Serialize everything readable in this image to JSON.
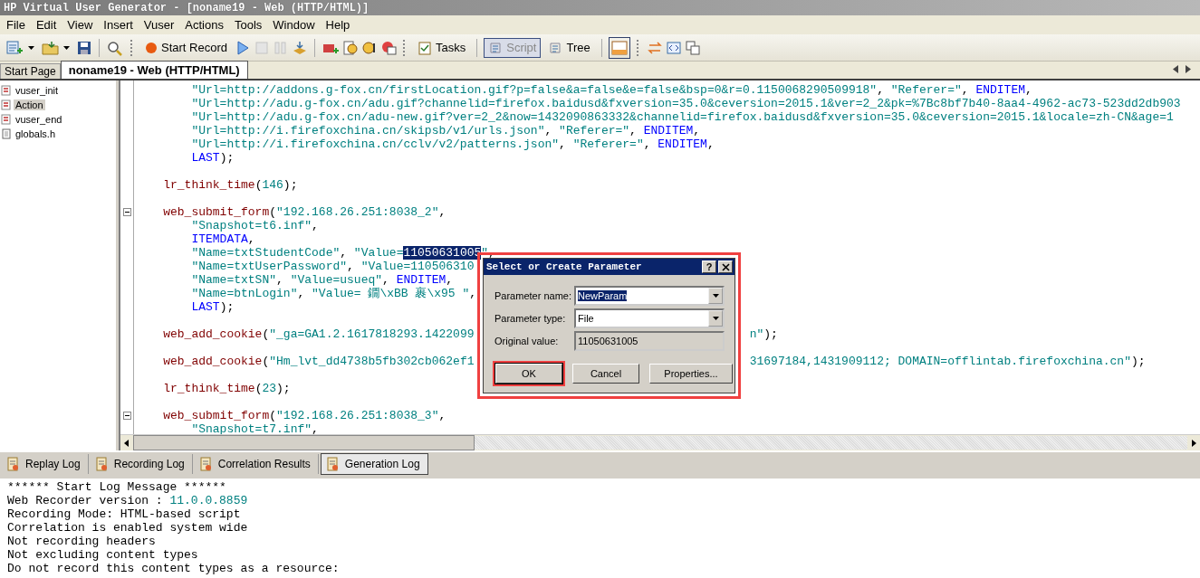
{
  "window": {
    "title": "HP Virtual User Generator - [noname19 - Web (HTTP/HTML)]"
  },
  "menu": [
    "File",
    "Edit",
    "View",
    "Insert",
    "Vuser",
    "Actions",
    "Tools",
    "Window",
    "Help"
  ],
  "toolbar": {
    "start_record": "Start Record",
    "tasks": "Tasks",
    "view_buttons": [
      {
        "label": "Script",
        "selected": true
      },
      {
        "label": "Tree",
        "selected": false
      }
    ]
  },
  "doc_tabs": [
    {
      "label": "Start Page",
      "selected": false
    },
    {
      "label": "noname19 - Web (HTTP/HTML)",
      "selected": true
    }
  ],
  "sidebar": {
    "items": [
      {
        "label": "vuser_init",
        "kind": "action",
        "selected": false
      },
      {
        "label": "Action",
        "kind": "action",
        "selected": true
      },
      {
        "label": "vuser_end",
        "kind": "action",
        "selected": false
      },
      {
        "label": "globals.h",
        "kind": "header",
        "selected": false
      }
    ]
  },
  "editor": {
    "lines": [
      {
        "fold": false,
        "tokens": [
          {
            "kind": "str",
            "text": "        \"Url=http://addons.g-fox.cn/firstLocation.gif?p=false&a=false&e=false&bsp=0&r=0.1150068290509918\""
          },
          {
            "kind": "plain",
            "text": ", "
          },
          {
            "kind": "str",
            "text": "\"Referer=\""
          },
          {
            "kind": "plain",
            "text": ", "
          },
          {
            "kind": "kw",
            "text": "ENDITEM"
          },
          {
            "kind": "plain",
            "text": ","
          }
        ]
      },
      {
        "fold": false,
        "tokens": [
          {
            "kind": "str",
            "text": "        \"Url=http://adu.g-fox.cn/adu.gif?channelid=firefox.baidusd&fxversion=35.0&ceversion=2015.1&ver=2_2&pk=%7Bc8bf7b40-8aa4-4962-ac73-523dd2db903"
          }
        ]
      },
      {
        "fold": false,
        "tokens": [
          {
            "kind": "str",
            "text": "        \"Url=http://adu.g-fox.cn/adu-new.gif?ver=2_2&now=1432090863332&channelid=firefox.baidusd&fxversion=35.0&ceversion=2015.1&locale=zh-CN&age=1"
          }
        ]
      },
      {
        "fold": false,
        "tokens": [
          {
            "kind": "str",
            "text": "        \"Url=http://i.firefoxchina.cn/skipsb/v1/urls.json\""
          },
          {
            "kind": "plain",
            "text": ", "
          },
          {
            "kind": "str",
            "text": "\"Referer=\""
          },
          {
            "kind": "plain",
            "text": ", "
          },
          {
            "kind": "kw",
            "text": "ENDITEM"
          },
          {
            "kind": "plain",
            "text": ","
          }
        ]
      },
      {
        "fold": false,
        "tokens": [
          {
            "kind": "str",
            "text": "        \"Url=http://i.firefoxchina.cn/cclv/v2/patterns.json\""
          },
          {
            "kind": "plain",
            "text": ", "
          },
          {
            "kind": "str",
            "text": "\"Referer=\""
          },
          {
            "kind": "plain",
            "text": ", "
          },
          {
            "kind": "kw",
            "text": "ENDITEM"
          },
          {
            "kind": "plain",
            "text": ","
          }
        ]
      },
      {
        "fold": false,
        "tokens": [
          {
            "kind": "kw",
            "text": "        LAST"
          },
          {
            "kind": "plain",
            "text": ");"
          }
        ]
      },
      {
        "fold": false
      },
      {
        "fold": false,
        "tokens": [
          {
            "kind": "fn",
            "text": "    lr_think_time"
          },
          {
            "kind": "plain",
            "text": "("
          },
          {
            "kind": "str",
            "text": "146"
          },
          {
            "kind": "plain",
            "text": ");"
          }
        ]
      },
      {
        "fold": false
      },
      {
        "fold": true,
        "tokens": [
          {
            "kind": "fn",
            "text": "    web_submit_form"
          },
          {
            "kind": "plain",
            "text": "("
          },
          {
            "kind": "str",
            "text": "\"192.168.26.251:8038_2\""
          },
          {
            "kind": "plain",
            "text": ","
          }
        ]
      },
      {
        "fold": false,
        "tokens": [
          {
            "kind": "str",
            "text": "        \"Snapshot=t6.inf\""
          },
          {
            "kind": "plain",
            "text": ","
          }
        ]
      },
      {
        "fold": false,
        "tokens": [
          {
            "kind": "kw",
            "text": "        ITEMDATA"
          },
          {
            "kind": "plain",
            "text": ","
          }
        ]
      },
      {
        "fold": false,
        "tokens": [
          {
            "kind": "str",
            "text": "        \"Name=txtStudentCode\""
          },
          {
            "kind": "plain",
            "text": ", "
          },
          {
            "kind": "str",
            "text": "\"Value="
          },
          {
            "kind": "sel",
            "text": "11050631005"
          },
          {
            "kind": "str",
            "text": "\""
          },
          {
            "kind": "plain",
            "text": ","
          }
        ]
      },
      {
        "fold": false,
        "tokens": [
          {
            "kind": "str",
            "text": "        \"Name=txtUserPassword\""
          },
          {
            "kind": "plain",
            "text": ", "
          },
          {
            "kind": "str",
            "text": "\"Value=110506310"
          }
        ]
      },
      {
        "fold": false,
        "tokens": [
          {
            "kind": "str",
            "text": "        \"Name=txtSN\""
          },
          {
            "kind": "plain",
            "text": ", "
          },
          {
            "kind": "str",
            "text": "\"Value=usueq\""
          },
          {
            "kind": "plain",
            "text": ", "
          },
          {
            "kind": "kw",
            "text": "ENDITEM"
          },
          {
            "kind": "plain",
            "text": ","
          }
        ]
      },
      {
        "fold": false,
        "tokens": [
          {
            "kind": "str",
            "text": "        \"Name=btnLogin\""
          },
          {
            "kind": "plain",
            "text": ", "
          },
          {
            "kind": "str",
            "text": "\"Value= 鐗\\xBB 裹\\x95 \""
          },
          {
            "kind": "plain",
            "text": ","
          }
        ]
      },
      {
        "fold": false,
        "tokens": [
          {
            "kind": "kw",
            "text": "        LAST"
          },
          {
            "kind": "plain",
            "text": ");"
          }
        ]
      },
      {
        "fold": false
      },
      {
        "fold": false,
        "tokens": [
          {
            "kind": "fn",
            "text": "    web_add_cookie"
          },
          {
            "kind": "plain",
            "text": "("
          },
          {
            "kind": "str",
            "text": "\"_ga=GA1.2.1617818293.1422099"
          }
        ],
        "tail": [
          {
            "kind": "str",
            "text": "n\""
          },
          {
            "kind": "plain",
            "text": ");"
          }
        ]
      },
      {
        "fold": false
      },
      {
        "fold": false,
        "tokens": [
          {
            "kind": "fn",
            "text": "    web_add_cookie"
          },
          {
            "kind": "plain",
            "text": "("
          },
          {
            "kind": "str",
            "text": "\"Hm_lvt_dd4738b5fb302cb062ef1"
          }
        ],
        "tail": [
          {
            "kind": "str",
            "text": "31697184,1431909112; DOMAIN=offlintab.firefoxchina.cn\""
          },
          {
            "kind": "plain",
            "text": ");"
          }
        ]
      },
      {
        "fold": false
      },
      {
        "fold": false,
        "tokens": [
          {
            "kind": "fn",
            "text": "    lr_think_time"
          },
          {
            "kind": "plain",
            "text": "("
          },
          {
            "kind": "str",
            "text": "23"
          },
          {
            "kind": "plain",
            "text": ");"
          }
        ]
      },
      {
        "fold": false
      },
      {
        "fold": true,
        "tokens": [
          {
            "kind": "fn",
            "text": "    web_submit_form"
          },
          {
            "kind": "plain",
            "text": "("
          },
          {
            "kind": "str",
            "text": "\"192.168.26.251:8038_3\""
          },
          {
            "kind": "plain",
            "text": ","
          }
        ]
      },
      {
        "fold": false,
        "tokens": [
          {
            "kind": "str",
            "text": "        \"Snapshot=t7.inf\""
          },
          {
            "kind": "plain",
            "text": ","
          }
        ]
      }
    ]
  },
  "output_tabs": [
    {
      "label": "Replay Log",
      "selected": false
    },
    {
      "label": "Recording Log",
      "selected": false
    },
    {
      "label": "Correlation Results",
      "selected": false
    },
    {
      "label": "Generation Log",
      "selected": true
    }
  ],
  "log": [
    {
      "text": "****** Start Log Message ******"
    },
    {
      "text": "Web Recorder version : ",
      "value": "11.0.0.8859"
    },
    {
      "text": "Recording Mode: HTML-based script"
    },
    {
      "text": "Correlation is enabled system wide"
    },
    {
      "text": "Not recording headers"
    },
    {
      "text": "Not excluding content types"
    },
    {
      "text": "Do not record this content types as a resource:"
    }
  ],
  "dialog": {
    "title": "Select or Create Parameter",
    "help": "?",
    "annotated": true,
    "fields": [
      {
        "label": "Parameter name:",
        "value": "NewParam",
        "kind": "combo"
      },
      {
        "label": "Parameter type:",
        "value": "File",
        "kind": "combo"
      },
      {
        "label": "Original value:",
        "value": "11050631005",
        "kind": "readonly"
      }
    ],
    "buttons": [
      {
        "label": "OK",
        "annotated": true
      },
      {
        "label": "Cancel",
        "annotated": false
      },
      {
        "label": "Properties...",
        "annotated": false
      }
    ]
  }
}
